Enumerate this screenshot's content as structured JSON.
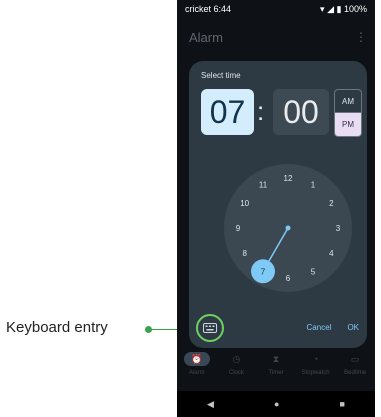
{
  "callout": {
    "label": "Keyboard entry"
  },
  "status_bar": {
    "carrier_time": "cricket 6:44",
    "battery": "100%"
  },
  "app_bar": {
    "title": "Alarm",
    "menu_icon": "⋮"
  },
  "dialog": {
    "title": "Select time",
    "hour": "07",
    "separator": ":",
    "minute": "00",
    "am_label": "AM",
    "pm_label": "PM",
    "selected_period": "PM",
    "cancel_label": "Cancel",
    "ok_label": "OK"
  },
  "clock_face": {
    "numbers": [
      "12",
      "1",
      "2",
      "3",
      "4",
      "5",
      "6",
      "7",
      "8",
      "9",
      "10",
      "11"
    ],
    "selected_hour": "7",
    "colors": {
      "face": "#3c4851",
      "hand": "#7ec9f5",
      "selected": "#7ec9f5"
    }
  },
  "bottom_nav": {
    "items": [
      {
        "label": "Alarm",
        "icon": "alarm-icon",
        "glyph": "⏰"
      },
      {
        "label": "Clock",
        "icon": "clock-icon",
        "glyph": "◷"
      },
      {
        "label": "Timer",
        "icon": "hourglass-icon",
        "glyph": "⧗"
      },
      {
        "label": "Stopwatch",
        "icon": "stopwatch-icon",
        "glyph": "◔"
      },
      {
        "label": "Bedtime",
        "icon": "bed-icon",
        "glyph": "▭"
      }
    ]
  },
  "system_nav": {
    "back": "◀",
    "home": "●",
    "recents": "■"
  }
}
